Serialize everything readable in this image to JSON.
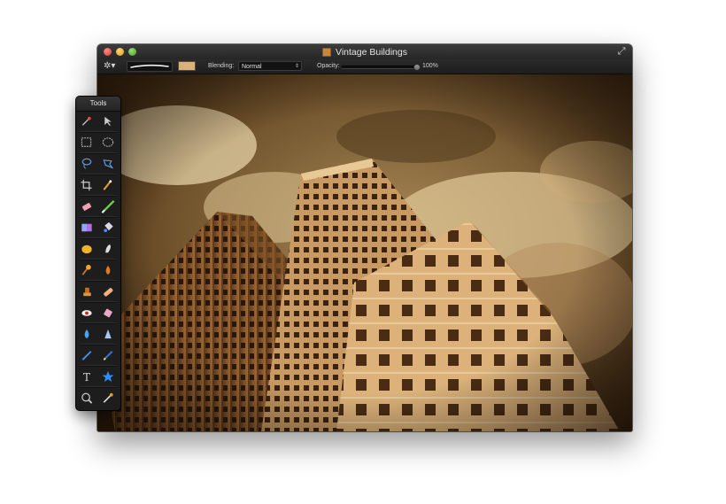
{
  "window": {
    "title": "Vintage Buildings",
    "title_icon": "image-document-icon",
    "fullscreen_icon": "fullscreen-arrows-icon"
  },
  "toolbar": {
    "settings_icon": "gear-icon",
    "brush_preview": "brush-stroke",
    "color_swatch": "#d9b27b",
    "blending_label": "Blending:",
    "blending_value": "Normal",
    "opacity_label": "Opacity:",
    "opacity_value": "100%",
    "opacity_fraction": 1.0
  },
  "tools_panel": {
    "title": "Tools",
    "rows": [
      [
        "magic-wand-icon",
        "move-arrow-icon"
      ],
      [
        "rectangle-select-icon",
        "ellipse-select-icon"
      ],
      [
        "lasso-icon",
        "polygonal-lasso-icon"
      ],
      [
        "crop-icon",
        "color-picker-icon"
      ],
      [
        "eraser-icon",
        "paint-brush-icon"
      ],
      [
        "gradient-icon",
        "paint-bucket-icon"
      ],
      [
        "sponge-icon",
        "smudge-icon"
      ],
      [
        "dodge-burn-icon",
        "blur-drop-icon"
      ],
      [
        "clone-stamp-icon",
        "bandage-icon"
      ],
      [
        "red-eye-icon",
        "eraser-pink-icon"
      ],
      [
        "water-drop-icon",
        "sharpen-cone-icon"
      ],
      [
        "pen-icon",
        "pencil-icon"
      ],
      [
        "text-icon",
        "shape-star-icon"
      ],
      [
        "zoom-icon",
        "eyedropper-icon"
      ]
    ]
  },
  "canvas": {
    "content": "vintage-buildings-photo",
    "sky_color": "#7b5d34",
    "building_color": "#d9a76a"
  }
}
